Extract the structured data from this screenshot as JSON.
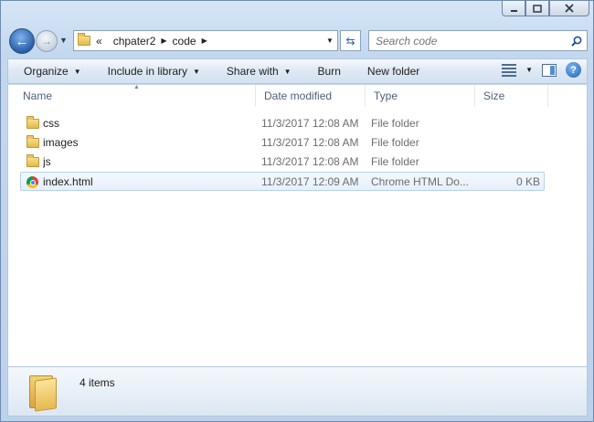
{
  "address": {
    "overflow": "«",
    "crumbs": [
      "chpater2",
      "code"
    ]
  },
  "search": {
    "placeholder": "Search code"
  },
  "toolbar": {
    "organize": "Organize",
    "include_in_library": "Include in library",
    "share_with": "Share with",
    "burn": "Burn",
    "new_folder": "New folder"
  },
  "columns": {
    "name": "Name",
    "date_modified": "Date modified",
    "type": "Type",
    "size": "Size"
  },
  "files": [
    {
      "name": "css",
      "date": "11/3/2017 12:08 AM",
      "type": "File folder",
      "size": "",
      "icon": "folder-icon"
    },
    {
      "name": "images",
      "date": "11/3/2017 12:08 AM",
      "type": "File folder",
      "size": "",
      "icon": "folder-icon"
    },
    {
      "name": "js",
      "date": "11/3/2017 12:08 AM",
      "type": "File folder",
      "size": "",
      "icon": "folder-icon"
    },
    {
      "name": "index.html",
      "date": "11/3/2017 12:09 AM",
      "type": "Chrome HTML Do...",
      "size": "0 KB",
      "icon": "chrome-icon"
    }
  ],
  "details": {
    "count": "4 items"
  }
}
